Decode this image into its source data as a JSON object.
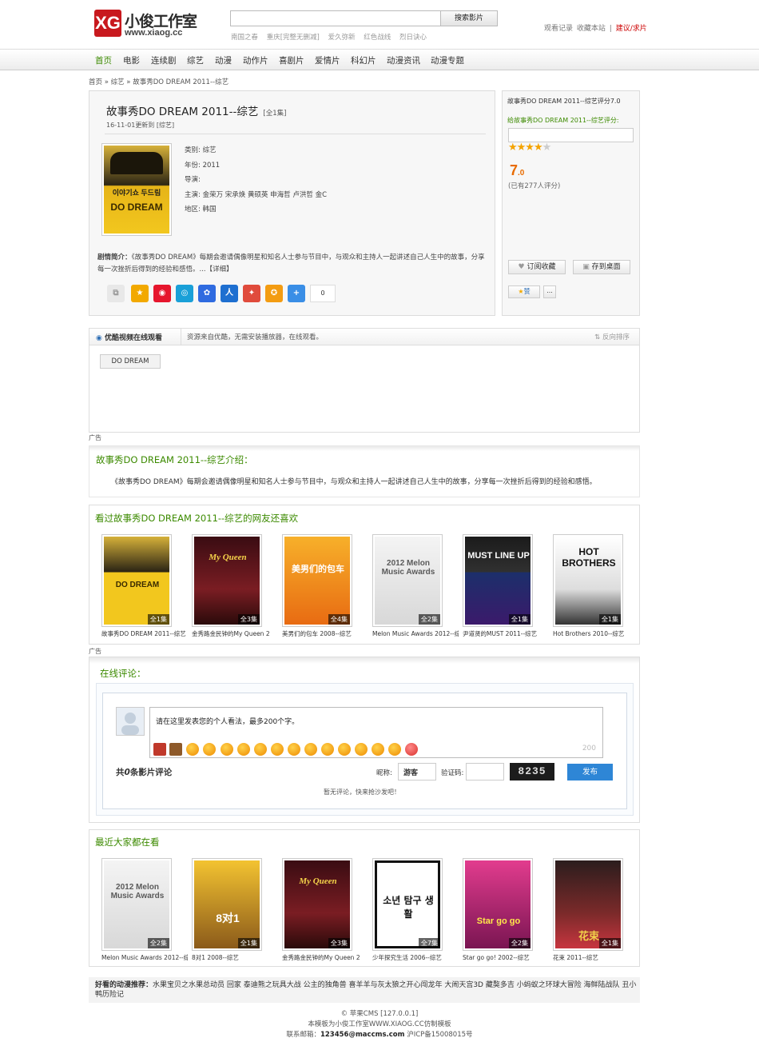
{
  "header": {
    "logo_mark": "XG",
    "logo_name": "小俊工作室",
    "logo_url": "www.xiaog.cc",
    "search_button": "搜索影片",
    "hot_words": [
      "南国之春",
      "重庆[完整无删减]",
      "爱久弥新",
      "红色战线",
      "烈日诀心"
    ],
    "top_links": [
      "观看记录",
      "收藏本站",
      "|",
      "建议/求片"
    ]
  },
  "nav": [
    "首页",
    "电影",
    "连续剧",
    "综艺",
    "动漫",
    "动作片",
    "喜剧片",
    "爱情片",
    "科幻片",
    "动漫资讯",
    "动漫专题"
  ],
  "breadcrumb": "首页  »  综艺  »  故事秀DO DREAM 2011--综艺",
  "detail": {
    "title": "故事秀DO DREAM 2011--综艺",
    "episodes": "[全1集]",
    "updated": "16-11-01更新到 [综艺]",
    "category": "类别: 综艺",
    "year": "年份: 2011",
    "director": "导演:",
    "cast": "主演: 金荣万 宋承焕 黄硕英 申海哲 卢洪哲 金C",
    "region": "地区: 韩国",
    "synopsis_label": "剧情简介：",
    "synopsis": "《故事秀DO DREAM》每期会邀请偶像明星和知名人士参与节目中，与观众和主持人一起讲述自己人生中的故事，分享每一次挫折后得到的经验和感悟。...【详细】",
    "share_count": "0",
    "poster_text_top": "이야기쇼 두드림",
    "poster_text_bottom": "DO DREAM"
  },
  "rating": {
    "line1": "故事秀DO DREAM 2011--综艺评分7.0",
    "line2": "给故事秀DO DREAM 2011--综艺评分:",
    "stars": "★★★★",
    "stars_off": "★",
    "score_int": "7",
    "score_dec": ".0",
    "votes": "(已有277人评分)",
    "subscribe": "订阅收藏",
    "desktop": "存到桌面",
    "like": "赞",
    "more": "..."
  },
  "play": {
    "title": "优酷视频在线观看",
    "desc": "资源来自优酷，无需安装播放器，在线观看。",
    "sort": "反向排序",
    "episode": "DO DREAM"
  },
  "ad_label": "广告",
  "intro": {
    "title": "故事秀DO DREAM 2011--综艺介绍：",
    "text": "《故事秀DO DREAM》每期会邀请偶像明星和知名人士参与节目中，与观众和主持人一起讲述自己人生中的故事，分享每一次挫折后得到的经验和感悟。"
  },
  "like": {
    "title": "看过故事秀DO DREAM 2011--综艺的网友还喜欢",
    "items": [
      {
        "tag": "全1集",
        "caption": "故事秀DO DREAM 2011--综艺",
        "poster": "DO DREAM"
      },
      {
        "tag": "全3集",
        "caption": "金秀路金民钟的My Queen 2",
        "poster": "My Queen"
      },
      {
        "tag": "全4集",
        "caption": "美男们的包车 2008--综艺",
        "poster": "美男们的包车"
      },
      {
        "tag": "全2集",
        "caption": "Melon Music Awards 2012--综艺",
        "poster": "2012 Melon Music Awards"
      },
      {
        "tag": "全1集",
        "caption": "尹道贤的MUST 2011--综艺",
        "poster": "MUST LINE UP"
      },
      {
        "tag": "全1集",
        "caption": "Hot Brothers 2010--综艺",
        "poster": "HOT BROTHERS"
      }
    ]
  },
  "comments": {
    "title": "在线评论：",
    "placeholder": "请在这里发表您的个人看法，最多200个字。",
    "char_count": "200",
    "total_prefix": "共",
    "total_num": "0",
    "total_suffix": "条影片评论",
    "nick_label": "昵称:",
    "nick_value": "游客",
    "code_label": "验证码:",
    "captcha": "8235",
    "post": "发布",
    "empty": "暂无评论，快来抢沙发吧！"
  },
  "recent": {
    "title": "最近大家都在看",
    "items": [
      {
        "tag": "全2集",
        "caption": "Melon Music Awards 2012--综艺",
        "poster": "2012 Melon Music Awards"
      },
      {
        "tag": "全1集",
        "caption": "8对1 2008--综艺",
        "poster": "8对1"
      },
      {
        "tag": "全3集",
        "caption": "金秀路金民钟的My Queen 2",
        "poster": "My Queen"
      },
      {
        "tag": "全7集",
        "caption": "少年探究生活 2006--综艺",
        "poster": "소년 탐구 생활"
      },
      {
        "tag": "全2集",
        "caption": "Star go go! 2002--综艺",
        "poster": "Star go go"
      },
      {
        "tag": "全1集",
        "caption": "花束 2011--综艺",
        "poster": "花束"
      }
    ]
  },
  "bottom_rec": {
    "label": "好看的动漫推荐：",
    "items": "水果宝贝之水果总动员   回家   泰迪熊之玩具大战   公主的独角兽   喜羊羊与灰太狼之开心闯龙年   大闹天宫3D   藏獒多吉   小蚂蚁之环球大冒险   海鲜陆战队   丑小鸭历险记"
  },
  "footer": {
    "line1": "© 苹果CMS [127.0.0.1]",
    "line2": "本模板为小俊工作室WWW.XIAOG.CC仿制模板",
    "line3_label": "联系邮箱：",
    "email": "123456@maccms.com",
    "icp": "沪ICP备15008015号"
  }
}
